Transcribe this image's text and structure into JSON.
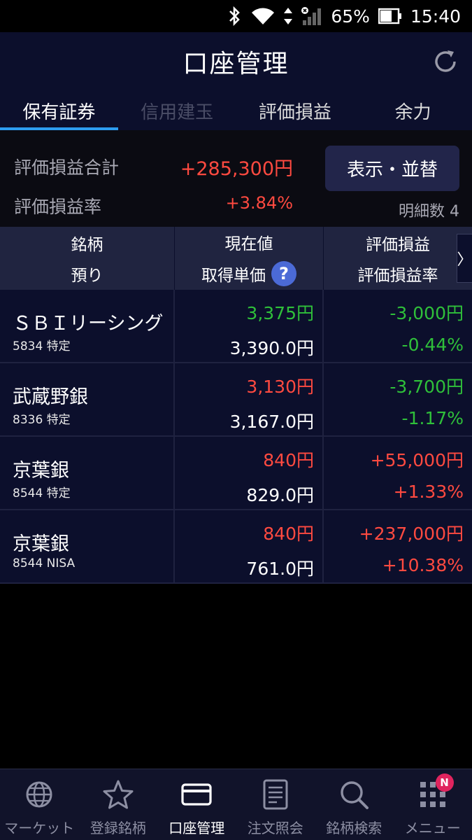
{
  "status_bar": {
    "battery": "65%",
    "time": "15:40"
  },
  "header": {
    "title": "口座管理"
  },
  "tabs": [
    {
      "label": "保有証券",
      "state": "active"
    },
    {
      "label": "信用建玉",
      "state": "disabled"
    },
    {
      "label": "評価損益",
      "state": "normal"
    },
    {
      "label": "余力",
      "state": "normal"
    }
  ],
  "summary": {
    "total_label": "評価損益合計",
    "total_value": "+285,300円",
    "rate_label": "評価損益率",
    "rate_value": "+3.84%",
    "sort_button": "表示・並替",
    "count_label": "明細数 4"
  },
  "table_header": {
    "col1_top": "銘柄",
    "col1_bottom": "預り",
    "col2_top": "現在値",
    "col2_bottom": "取得単価",
    "help_symbol": "?",
    "col3_top": "評価損益",
    "col3_bottom": "評価損益率",
    "scroll_glyph": "〉"
  },
  "rows": [
    {
      "name": "ＳＢＩリーシング",
      "code": "5834 特定",
      "price": "3,375円",
      "price_color": "green",
      "cost": "3,390.0円",
      "pl": "-3,000円",
      "pl_rate": "-0.44%",
      "pl_color": "green"
    },
    {
      "name": "武蔵野銀",
      "code": "8336 特定",
      "price": "3,130円",
      "price_color": "red",
      "cost": "3,167.0円",
      "pl": "-3,700円",
      "pl_rate": "-1.17%",
      "pl_color": "green"
    },
    {
      "name": "京葉銀",
      "code": "8544 特定",
      "price": "840円",
      "price_color": "red",
      "cost": "829.0円",
      "pl": "+55,000円",
      "pl_rate": "+1.33%",
      "pl_color": "red"
    },
    {
      "name": "京葉銀",
      "code": "8544 NISA",
      "price": "840円",
      "price_color": "red",
      "cost": "761.0円",
      "pl": "+237,000円",
      "pl_rate": "+10.38%",
      "pl_color": "red"
    }
  ],
  "bottom_nav": [
    {
      "label": "マーケット",
      "icon": "globe-icon",
      "active": false
    },
    {
      "label": "登録銘柄",
      "icon": "star-icon",
      "active": false
    },
    {
      "label": "口座管理",
      "icon": "card-icon",
      "active": true
    },
    {
      "label": "注文照会",
      "icon": "document-icon",
      "active": false
    },
    {
      "label": "銘柄検索",
      "icon": "search-icon",
      "active": false
    },
    {
      "label": "メニュー",
      "icon": "grid-menu-icon",
      "active": false,
      "badge": "N"
    }
  ],
  "colors": {
    "gain": "#ff4a40",
    "loss": "#2fc03a",
    "accent": "#2d9cf0",
    "header_bg": "#0c0f2c"
  }
}
